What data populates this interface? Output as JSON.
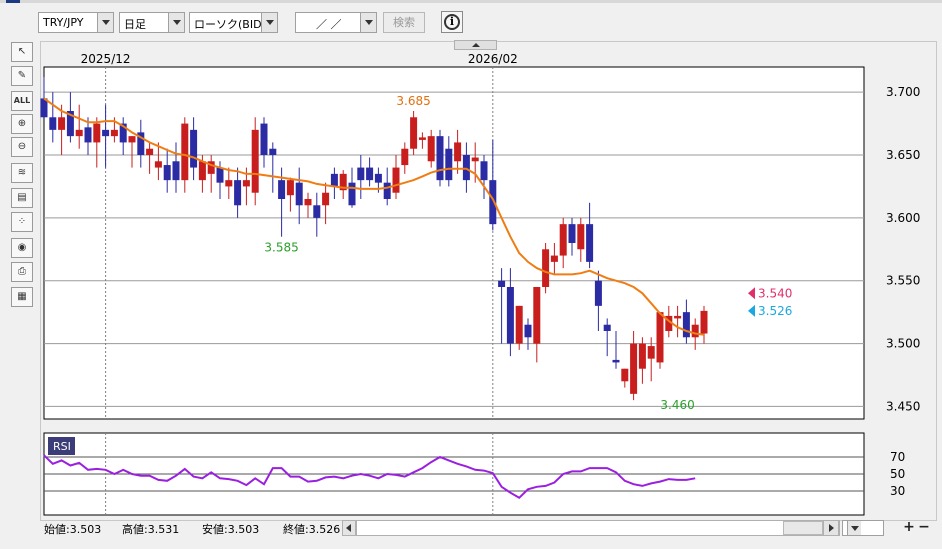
{
  "header": {
    "pair": "TRY/JPY",
    "timeframe": "日足",
    "chart_type": "ローソク(BID)",
    "date_value": "／ ／",
    "search_label": "検索",
    "info_label": "i"
  },
  "toolbar": [
    {
      "name": "cursor-tool",
      "label": "↖"
    },
    {
      "name": "pencil-tool",
      "label": "✎"
    },
    {
      "name": "erase-all-tool",
      "label": "ALL"
    },
    {
      "name": "zoom-in-tool",
      "label": "⊕"
    },
    {
      "name": "zoom-out-tool",
      "label": "⊖"
    },
    {
      "name": "indicator-tool",
      "label": "≋"
    },
    {
      "name": "price-table-tool",
      "label": "▤"
    },
    {
      "name": "marker-tool",
      "label": "⁘"
    },
    {
      "name": "eye-tool",
      "label": "◉"
    },
    {
      "name": "print-tool",
      "label": "⎙"
    },
    {
      "name": "settings-tool",
      "label": "▦"
    }
  ],
  "chart_data": {
    "type": "candlestick",
    "x_labels": [
      {
        "index": 7,
        "label": "2025/12"
      },
      {
        "index": 51,
        "label": "2026/02"
      }
    ],
    "ylim": [
      3.44,
      3.72
    ],
    "yticks": [
      "3.700",
      "3.650",
      "3.600",
      "3.550",
      "3.500",
      "3.450"
    ],
    "candles": [
      [
        3.695,
        3.712,
        3.685,
        3.68
      ],
      [
        3.68,
        3.7,
        3.66,
        3.67
      ],
      [
        3.67,
        3.69,
        3.65,
        3.68
      ],
      [
        3.685,
        3.7,
        3.66,
        3.665
      ],
      [
        3.665,
        3.69,
        3.655,
        3.67
      ],
      [
        3.672,
        3.68,
        3.65,
        3.66
      ],
      [
        3.66,
        3.68,
        3.64,
        3.675
      ],
      [
        3.67,
        3.69,
        3.64,
        3.665
      ],
      [
        3.665,
        3.68,
        3.66,
        3.67
      ],
      [
        3.675,
        3.68,
        3.65,
        3.66
      ],
      [
        3.66,
        3.665,
        3.64,
        3.665
      ],
      [
        3.668,
        3.678,
        3.64,
        3.65
      ],
      [
        3.65,
        3.66,
        3.635,
        3.655
      ],
      [
        3.64,
        3.66,
        3.63,
        3.645
      ],
      [
        3.642,
        3.655,
        3.62,
        3.63
      ],
      [
        3.645,
        3.66,
        3.62,
        3.63
      ],
      [
        3.63,
        3.68,
        3.62,
        3.675
      ],
      [
        3.67,
        3.68,
        3.63,
        3.64
      ],
      [
        3.63,
        3.65,
        3.62,
        3.645
      ],
      [
        3.635,
        3.65,
        3.62,
        3.645
      ],
      [
        3.64,
        3.645,
        3.615,
        3.628
      ],
      [
        3.625,
        3.64,
        3.615,
        3.63
      ],
      [
        3.63,
        3.64,
        3.6,
        3.61
      ],
      [
        3.625,
        3.64,
        3.61,
        3.63
      ],
      [
        3.62,
        3.68,
        3.61,
        3.67
      ],
      [
        3.675,
        3.68,
        3.64,
        3.65
      ],
      [
        3.655,
        3.66,
        3.62,
        3.65
      ],
      [
        3.63,
        3.64,
        3.585,
        3.615
      ],
      [
        3.618,
        3.632,
        3.605,
        3.63
      ],
      [
        3.628,
        3.64,
        3.595,
        3.61
      ],
      [
        3.61,
        3.62,
        3.6,
        3.615
      ],
      [
        3.61,
        3.62,
        3.585,
        3.6
      ],
      [
        3.61,
        3.628,
        3.595,
        3.62
      ],
      [
        3.635,
        3.64,
        3.615,
        3.625
      ],
      [
        3.622,
        3.638,
        3.615,
        3.635
      ],
      [
        3.628,
        3.64,
        3.608,
        3.61
      ],
      [
        3.64,
        3.65,
        3.615,
        3.63
      ],
      [
        3.64,
        3.648,
        3.625,
        3.63
      ],
      [
        3.635,
        3.64,
        3.62,
        3.628
      ],
      [
        3.628,
        3.64,
        3.61,
        3.615
      ],
      [
        3.62,
        3.65,
        3.615,
        3.64
      ],
      [
        3.642,
        3.66,
        3.635,
        3.655
      ],
      [
        3.655,
        3.685,
        3.65,
        3.68
      ],
      [
        3.662,
        3.668,
        3.655,
        3.664
      ],
      [
        3.645,
        3.67,
        3.64,
        3.665
      ],
      [
        3.665,
        3.67,
        3.625,
        3.63
      ],
      [
        3.655,
        3.665,
        3.625,
        3.63
      ],
      [
        3.645,
        3.67,
        3.635,
        3.66
      ],
      [
        3.65,
        3.66,
        3.62,
        3.63
      ],
      [
        3.645,
        3.66,
        3.628,
        3.648
      ],
      [
        3.645,
        3.65,
        3.615,
        3.63
      ],
      [
        3.63,
        3.662,
        3.59,
        3.595
      ],
      [
        3.55,
        3.56,
        3.5,
        3.545
      ],
      [
        3.545,
        3.56,
        3.49,
        3.5
      ],
      [
        3.5,
        3.53,
        3.495,
        3.53
      ],
      [
        3.515,
        3.52,
        3.495,
        3.505
      ],
      [
        3.5,
        3.54,
        3.485,
        3.545
      ],
      [
        3.545,
        3.58,
        3.54,
        3.575
      ],
      [
        3.565,
        3.58,
        3.555,
        3.57
      ],
      [
        3.57,
        3.6,
        3.56,
        3.595
      ],
      [
        3.595,
        3.6,
        3.57,
        3.58
      ],
      [
        3.575,
        3.6,
        3.565,
        3.595
      ],
      [
        3.595,
        3.612,
        3.56,
        3.565
      ],
      [
        3.55,
        3.558,
        3.51,
        3.53
      ],
      [
        3.515,
        3.52,
        3.49,
        3.51
      ],
      [
        3.487,
        3.51,
        3.48,
        3.485
      ],
      [
        3.47,
        3.48,
        3.465,
        3.48
      ],
      [
        3.46,
        3.51,
        3.455,
        3.5
      ],
      [
        3.48,
        3.505,
        3.468,
        3.5
      ],
      [
        3.488,
        3.505,
        3.47,
        3.498
      ],
      [
        3.485,
        3.525,
        3.48,
        3.525
      ],
      [
        3.51,
        3.53,
        3.505,
        3.522
      ],
      [
        3.52,
        3.53,
        3.505,
        3.522
      ],
      [
        3.525,
        3.535,
        3.5,
        3.505
      ],
      [
        3.505,
        3.52,
        3.495,
        3.515
      ],
      [
        3.508,
        3.53,
        3.5,
        3.526
      ]
    ],
    "ma_values": [
      3.695,
      3.69,
      3.685,
      3.682,
      3.679,
      3.676,
      3.676,
      3.677,
      3.677,
      3.673,
      3.668,
      3.664,
      3.66,
      3.657,
      3.654,
      3.651,
      3.65,
      3.648,
      3.645,
      3.642,
      3.64,
      3.638,
      3.637,
      3.635,
      3.635,
      3.634,
      3.633,
      3.632,
      3.631,
      3.63,
      3.629,
      3.627,
      3.626,
      3.625,
      3.624,
      3.624,
      3.623,
      3.623,
      3.623,
      3.624,
      3.626,
      3.628,
      3.63,
      3.633,
      3.636,
      3.638,
      3.639,
      3.639,
      3.639,
      3.635,
      3.625,
      3.615,
      3.6,
      3.585,
      3.572,
      3.565,
      3.56,
      3.557,
      3.555,
      3.555,
      3.555,
      3.556,
      3.558,
      3.555,
      3.552,
      3.55,
      3.548,
      3.545,
      3.54,
      3.532,
      3.524,
      3.518,
      3.513,
      3.51,
      3.508,
      3.507
    ],
    "annotations": [
      {
        "index": 42,
        "value": 3.685,
        "label": "3.685",
        "color": "#e07010",
        "pos": "above"
      },
      {
        "index": 27,
        "value": 3.585,
        "label": "3.585",
        "color": "#2aa02a",
        "pos": "below"
      },
      {
        "index": 72,
        "value": 3.46,
        "label": "3.460",
        "color": "#2aa02a",
        "pos": "below"
      }
    ],
    "markers": [
      {
        "label": "3.540",
        "value": 3.54,
        "color": "#e0306a"
      },
      {
        "label": "3.526",
        "value": 3.526,
        "color": "#1aa8e0"
      }
    ],
    "rsi": {
      "label": "RSI",
      "levels": [
        "70",
        "50",
        "30"
      ],
      "values": [
        72,
        62,
        66,
        60,
        63,
        55,
        56,
        55,
        50,
        55,
        50,
        48,
        48,
        43,
        42,
        48,
        56,
        47,
        45,
        52,
        45,
        44,
        42,
        37,
        45,
        38,
        57,
        57,
        47,
        47,
        41,
        42,
        46,
        47,
        45,
        48,
        50,
        48,
        45,
        50,
        49,
        47,
        52,
        57,
        64,
        70,
        66,
        62,
        59,
        55,
        54,
        51,
        35,
        28,
        22,
        32,
        35,
        36,
        40,
        50,
        53,
        53,
        57,
        57,
        57,
        52,
        42,
        38,
        36,
        39,
        41,
        44,
        43,
        43,
        45
      ]
    },
    "colors": {
      "up": "#c81e1e",
      "down": "#2b2ba3",
      "ma": "#f07d14",
      "rsi": "#9b1fe0",
      "grid": "#9a9a9a",
      "vline": "#808080"
    }
  },
  "status": {
    "open": "始値:3.503",
    "high": "高値:3.531",
    "low": "安値:3.503",
    "close": "終値:3.526"
  },
  "bars_visible": "80"
}
